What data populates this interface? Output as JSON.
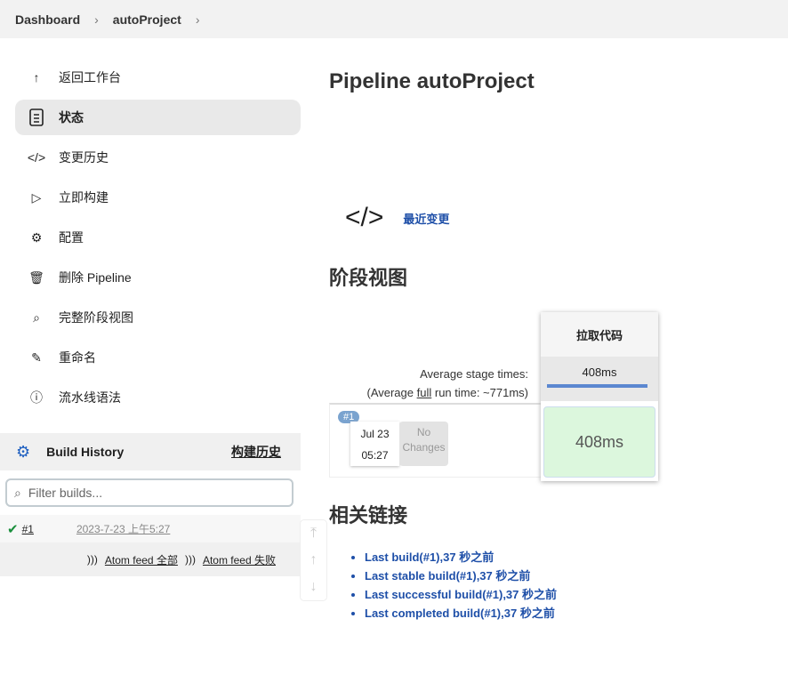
{
  "breadcrumb": [
    "Dashboard",
    "autoProject"
  ],
  "sidebar": {
    "items": [
      {
        "label": "返回工作台",
        "icon": "arrow-up-icon"
      },
      {
        "label": "状态",
        "icon": "document-icon"
      },
      {
        "label": "变更历史",
        "icon": "code-icon"
      },
      {
        "label": "立即构建",
        "icon": "play-icon"
      },
      {
        "label": "配置",
        "icon": "gear-icon"
      },
      {
        "label": "删除 Pipeline",
        "icon": "trash-icon"
      },
      {
        "label": "完整阶段视图",
        "icon": "search-icon"
      },
      {
        "label": "重命名",
        "icon": "pencil-icon"
      },
      {
        "label": "流水线语法",
        "icon": "help-icon"
      }
    ]
  },
  "build_history": {
    "title": "Build History",
    "trend": "构建历史",
    "filter_placeholder": "Filter builds...",
    "builds": [
      {
        "number": "#1",
        "date": "2023-7-23 上午5:27",
        "status": "success"
      }
    ],
    "feed_all": "Atom feed 全部",
    "feed_failed": "Atom feed 失败"
  },
  "main": {
    "title": "Pipeline autoProject",
    "recent_changes": "最近变更",
    "stage_view_title": "阶段视图",
    "avg_stage": "Average stage times:",
    "avg_full_pre": "(Average ",
    "avg_full_link": "full",
    "avg_full_post": " run time: ~771ms)",
    "build": {
      "badge": "#1",
      "date": "Jul 23",
      "time": "05:27",
      "changes": "No Changes"
    },
    "stage": {
      "name": "拉取代码",
      "avg": "408ms",
      "avg_progress": 1.0,
      "cell": "408ms",
      "color": "#dcf7dd"
    },
    "related_title": "相关链接",
    "links": [
      "Last build(#1),37 秒之前",
      "Last stable build(#1),37 秒之前",
      "Last successful build(#1),37 秒之前",
      "Last completed build(#1),37 秒之前"
    ]
  }
}
